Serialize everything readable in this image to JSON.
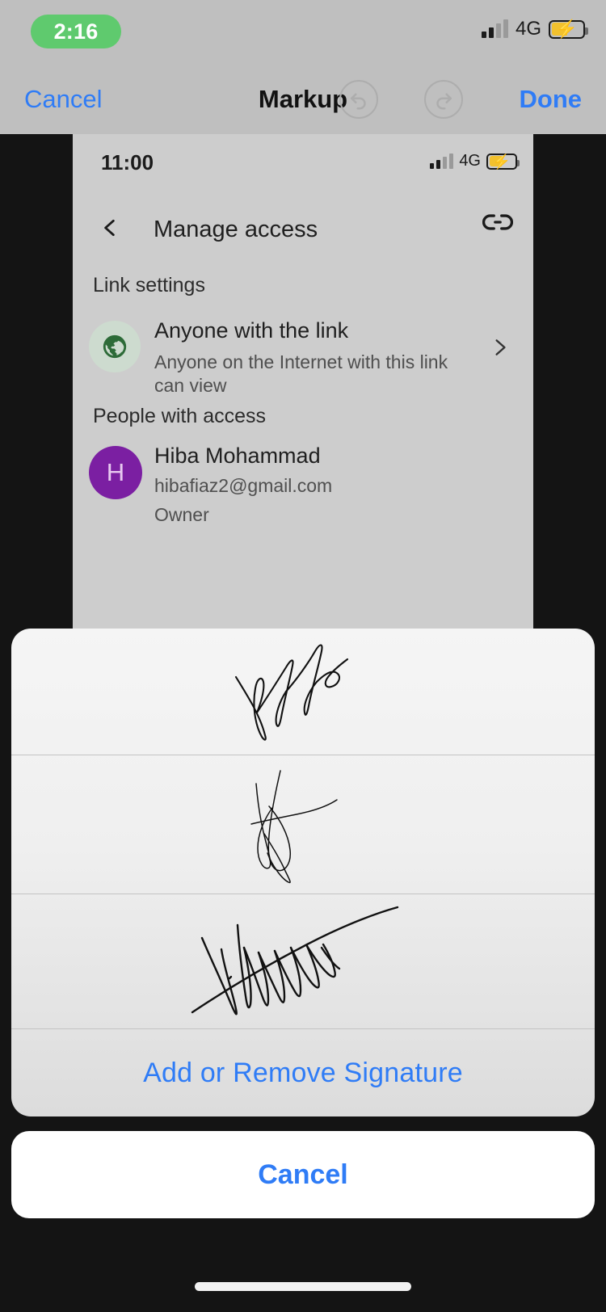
{
  "status_bar": {
    "time": "2:16",
    "network": "4G",
    "signal_icon": "signal-bars-icon",
    "battery_icon": "battery-charging-icon"
  },
  "markup_toolbar": {
    "cancel_label": "Cancel",
    "title": "Markup",
    "done_label": "Done",
    "undo_icon": "undo-icon",
    "redo_icon": "redo-icon"
  },
  "screenshot": {
    "status_bar": {
      "time": "11:00",
      "network": "4G",
      "signal_icon": "signal-bars-icon",
      "battery_icon": "battery-charging-icon"
    },
    "app_bar": {
      "back_icon": "back-chevron-icon",
      "title": "Manage access",
      "link_icon": "link-icon"
    },
    "link_settings": {
      "section_label": "Link settings",
      "icon": "globe-icon",
      "title": "Anyone with the link",
      "subtitle": "Anyone on the Internet with this link can view",
      "chevron_icon": "chevron-right-icon"
    },
    "people_with_access": {
      "section_label": "People with access",
      "people": [
        {
          "avatar_initial": "H",
          "avatar_color": "#7b1fa2",
          "name": "Hiba Mohammad",
          "email": "hibafiaz2@gmail.com",
          "role": "Owner"
        }
      ]
    }
  },
  "signature_sheet": {
    "signatures": [
      {
        "name": "signature-1"
      },
      {
        "name": "signature-2"
      },
      {
        "name": "signature-3"
      }
    ],
    "add_remove_label": "Add or Remove Signature",
    "cancel_label": "Cancel"
  },
  "home_indicator": "home-indicator",
  "colors": {
    "accent_blue": "#2f7cf6",
    "time_pill_green": "#5fca6e",
    "battery_yellow": "#f2c12e",
    "avatar_purple": "#7b1fa2",
    "globe_green": "#2d6b38",
    "chrome_gray": "#bfbfbf",
    "screenshot_gray": "#cdcdcd",
    "backdrop": "#141414"
  }
}
